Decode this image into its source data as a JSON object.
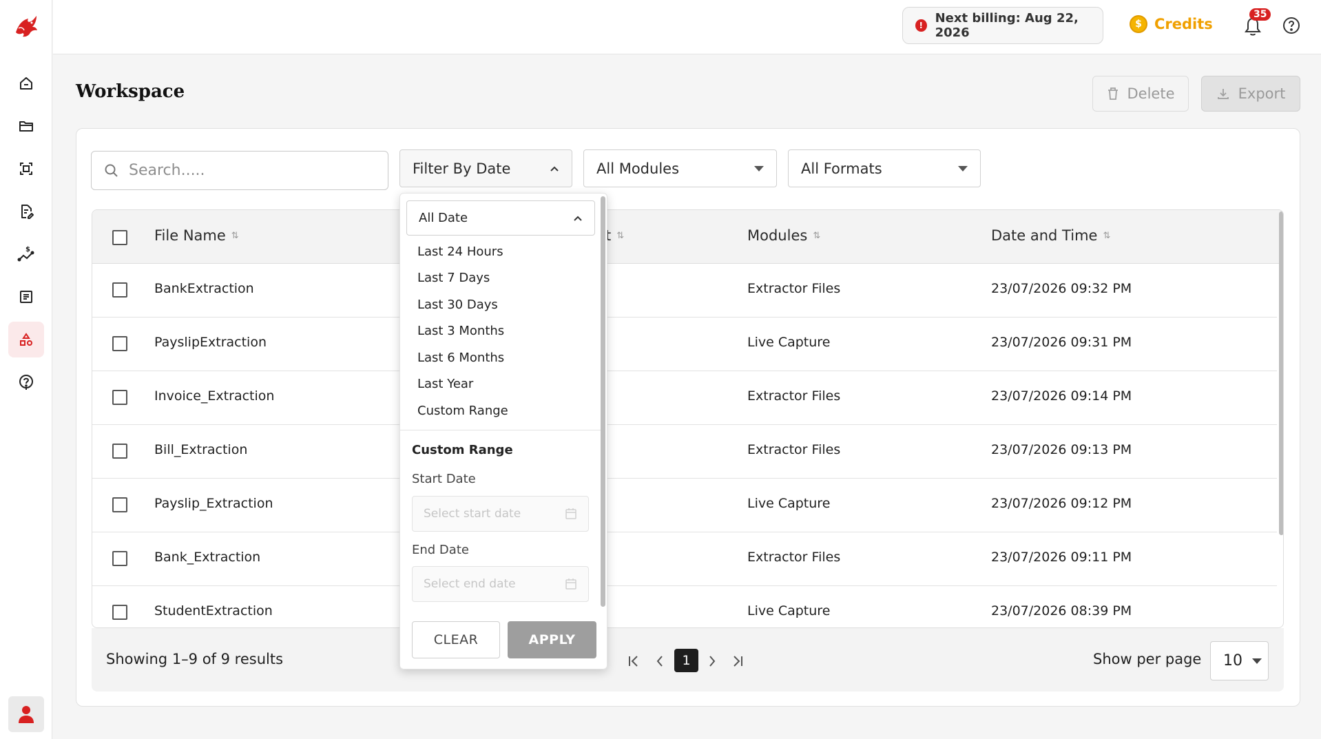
{
  "colors": {
    "brand": "#d82121",
    "credits": "#f0a000",
    "active_nav_bg": "#fbe9ea"
  },
  "sidebar": {
    "logo_icon": "brand-dragon-logo",
    "items": [
      {
        "name": "home-icon"
      },
      {
        "name": "folder-icon"
      },
      {
        "name": "scan-icon"
      },
      {
        "name": "document-edit-icon"
      },
      {
        "name": "billing-graph-icon"
      },
      {
        "name": "checklist-icon"
      },
      {
        "name": "shapes-icon",
        "active": true
      },
      {
        "name": "help-icon"
      }
    ],
    "user_icon": "user-icon"
  },
  "topbar": {
    "billing_text": "Next billing: Aug 22, 2026",
    "credits_label": "Credits",
    "coin_symbol": "$",
    "notification_count": "35"
  },
  "page": {
    "title": "Workspace",
    "delete_label": "Delete",
    "export_label": "Export"
  },
  "filters": {
    "search_placeholder": "Search.....",
    "date_filter_label": "Filter By Date",
    "modules_label": "All Modules",
    "formats_label": "All Formats"
  },
  "date_dropdown": {
    "selected": "All Date",
    "options": [
      "Last 24 Hours",
      "Last 7 Days",
      "Last 30 Days",
      "Last 3 Months",
      "Last 6 Months",
      "Last Year",
      "Custom Range"
    ],
    "custom_section_title": "Custom Range",
    "start_label": "Start Date",
    "start_placeholder": "Select start date",
    "end_label": "End Date",
    "end_placeholder": "Select end date",
    "clear_label": "CLEAR",
    "apply_label": "APPLY"
  },
  "table": {
    "columns": [
      "File Name",
      "t",
      "Modules",
      "Date and Time"
    ],
    "rows": [
      {
        "file": "BankExtraction",
        "module": "Extractor Files",
        "datetime": "23/07/2026 09:32 PM"
      },
      {
        "file": "PayslipExtraction",
        "module": "Live Capture",
        "datetime": "23/07/2026 09:31 PM"
      },
      {
        "file": "Invoice_Extraction",
        "module": "Extractor Files",
        "datetime": "23/07/2026 09:14 PM"
      },
      {
        "file": "Bill_Extraction",
        "module": "Extractor Files",
        "datetime": "23/07/2026 09:13 PM"
      },
      {
        "file": "Payslip_Extraction",
        "module": "Live Capture",
        "datetime": "23/07/2026 09:12 PM"
      },
      {
        "file": "Bank_Extraction",
        "module": "Extractor Files",
        "datetime": "23/07/2026 09:11 PM"
      },
      {
        "file": "StudentExtraction",
        "module": "Live Capture",
        "datetime": "23/07/2026 08:39 PM"
      }
    ]
  },
  "footer": {
    "showing_text": "Showing 1–9 of 9 results",
    "current_page": "1",
    "per_page_label": "Show per page",
    "per_page_value": "10"
  }
}
